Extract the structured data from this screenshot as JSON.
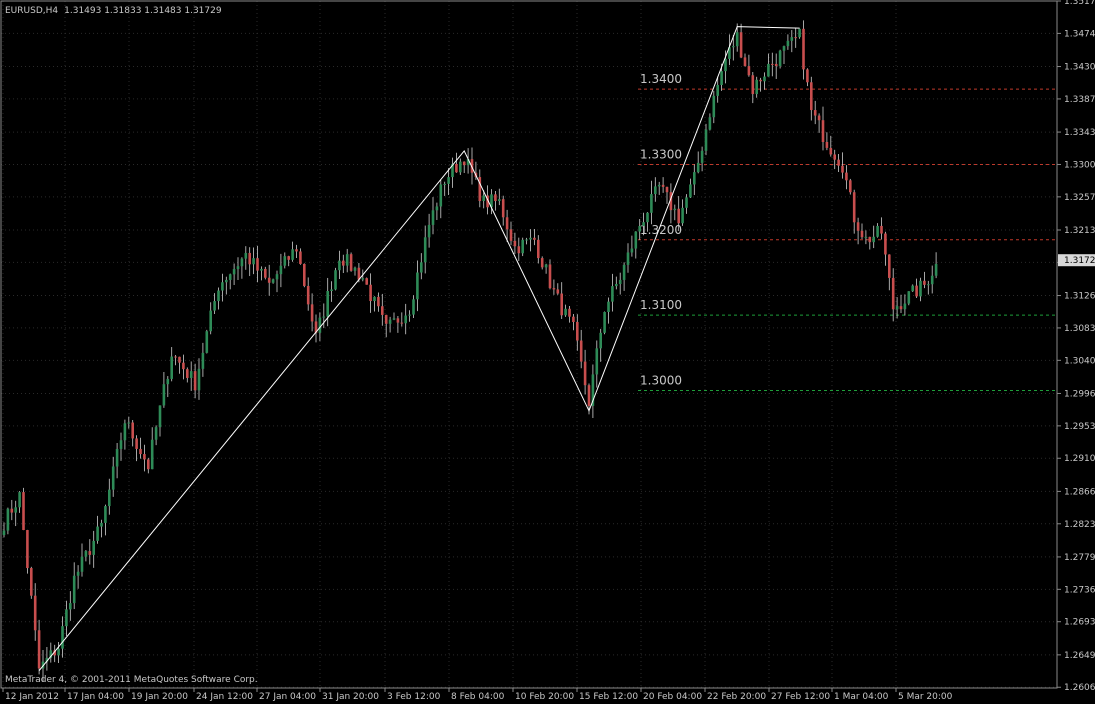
{
  "header": {
    "symbol": "EURUSD,H4",
    "quotes": "1.31493 1.31833 1.31483 1.31729"
  },
  "copyright": "MetaTrader 4, © 2001-2011 MetaQuotes Software Corp.",
  "colors": {
    "background": "#000000",
    "grid": "#2a2a2a",
    "bull": "#2e8b57",
    "bear": "#c84e4e",
    "zigzag": "#ffffff",
    "resistance": "#c0392b",
    "support": "#1e9e3a",
    "price_label_bg": "#d8d8d8"
  },
  "chart_data": {
    "type": "candlestick",
    "symbol": "EURUSD",
    "timeframe": "H4",
    "ylim": [
      1.2605,
      1.3517
    ],
    "y_ticks": [
      "1.35170",
      "1.34740",
      "1.34300",
      "1.33870",
      "1.33430",
      "1.33000",
      "1.32570",
      "1.32130",
      "1.31700",
      "1.31260",
      "1.30830",
      "1.30400",
      "1.29960",
      "1.29530",
      "1.29100",
      "1.28660",
      "1.28230",
      "1.27790",
      "1.27360",
      "1.26930",
      "1.26490",
      "1.26060"
    ],
    "current_price": "1.31729",
    "x_ticks": [
      "12 Jan 2012",
      "17 Jan 04:00",
      "19 Jan 20:00",
      "24 Jan 12:00",
      "27 Jan 04:00",
      "31 Jan 20:00",
      "3 Feb 12:00",
      "8 Feb 04:00",
      "10 Feb 20:00",
      "15 Feb 12:00",
      "20 Feb 04:00",
      "22 Feb 20:00",
      "27 Feb 12:00",
      "1 Mar 04:00",
      "5 Mar 20:00"
    ],
    "zigzag": [
      {
        "bar": 9,
        "price": 1.2628
      },
      {
        "bar": 118,
        "price": 1.3318
      },
      {
        "bar": 150,
        "price": 1.2973
      },
      {
        "bar": 188,
        "price": 1.3483
      },
      {
        "bar": 204,
        "price": 1.3481
      }
    ],
    "levels": [
      {
        "label": "1.3400",
        "value": 1.34,
        "kind": "resistance"
      },
      {
        "label": "1.3300",
        "value": 1.33,
        "kind": "resistance"
      },
      {
        "label": "1.3200",
        "value": 1.32,
        "kind": "resistance"
      },
      {
        "label": "1.3100",
        "value": 1.31,
        "kind": "support"
      },
      {
        "label": "1.3000",
        "value": 1.3,
        "kind": "support"
      }
    ],
    "anchors": [
      [
        0,
        1.2825
      ],
      [
        4,
        1.286
      ],
      [
        9,
        1.263
      ],
      [
        14,
        1.266
      ],
      [
        18,
        1.275
      ],
      [
        25,
        1.282
      ],
      [
        31,
        1.296
      ],
      [
        37,
        1.29
      ],
      [
        43,
        1.305
      ],
      [
        49,
        1.301
      ],
      [
        55,
        1.314
      ],
      [
        62,
        1.318
      ],
      [
        68,
        1.314
      ],
      [
        75,
        1.319
      ],
      [
        80,
        1.307
      ],
      [
        86,
        1.318
      ],
      [
        92,
        1.315
      ],
      [
        98,
        1.308
      ],
      [
        104,
        1.311
      ],
      [
        109,
        1.322
      ],
      [
        113,
        1.328
      ],
      [
        118,
        1.331
      ],
      [
        123,
        1.325
      ],
      [
        127,
        1.325
      ],
      [
        131,
        1.319
      ],
      [
        136,
        1.32
      ],
      [
        141,
        1.313
      ],
      [
        146,
        1.308
      ],
      [
        150,
        1.2985
      ],
      [
        154,
        1.311
      ],
      [
        158,
        1.315
      ],
      [
        163,
        1.322
      ],
      [
        168,
        1.327
      ],
      [
        173,
        1.323
      ],
      [
        177,
        1.328
      ],
      [
        181,
        1.337
      ],
      [
        185,
        1.344
      ],
      [
        188,
        1.347
      ],
      [
        192,
        1.34
      ],
      [
        196,
        1.343
      ],
      [
        200,
        1.345
      ],
      [
        204,
        1.347
      ],
      [
        207,
        1.337
      ],
      [
        211,
        1.333
      ],
      [
        215,
        1.33
      ],
      [
        218,
        1.323
      ],
      [
        221,
        1.32
      ],
      [
        225,
        1.321
      ],
      [
        228,
        1.311
      ],
      [
        232,
        1.3125
      ],
      [
        236,
        1.314
      ],
      [
        239,
        1.3168
      ]
    ]
  }
}
